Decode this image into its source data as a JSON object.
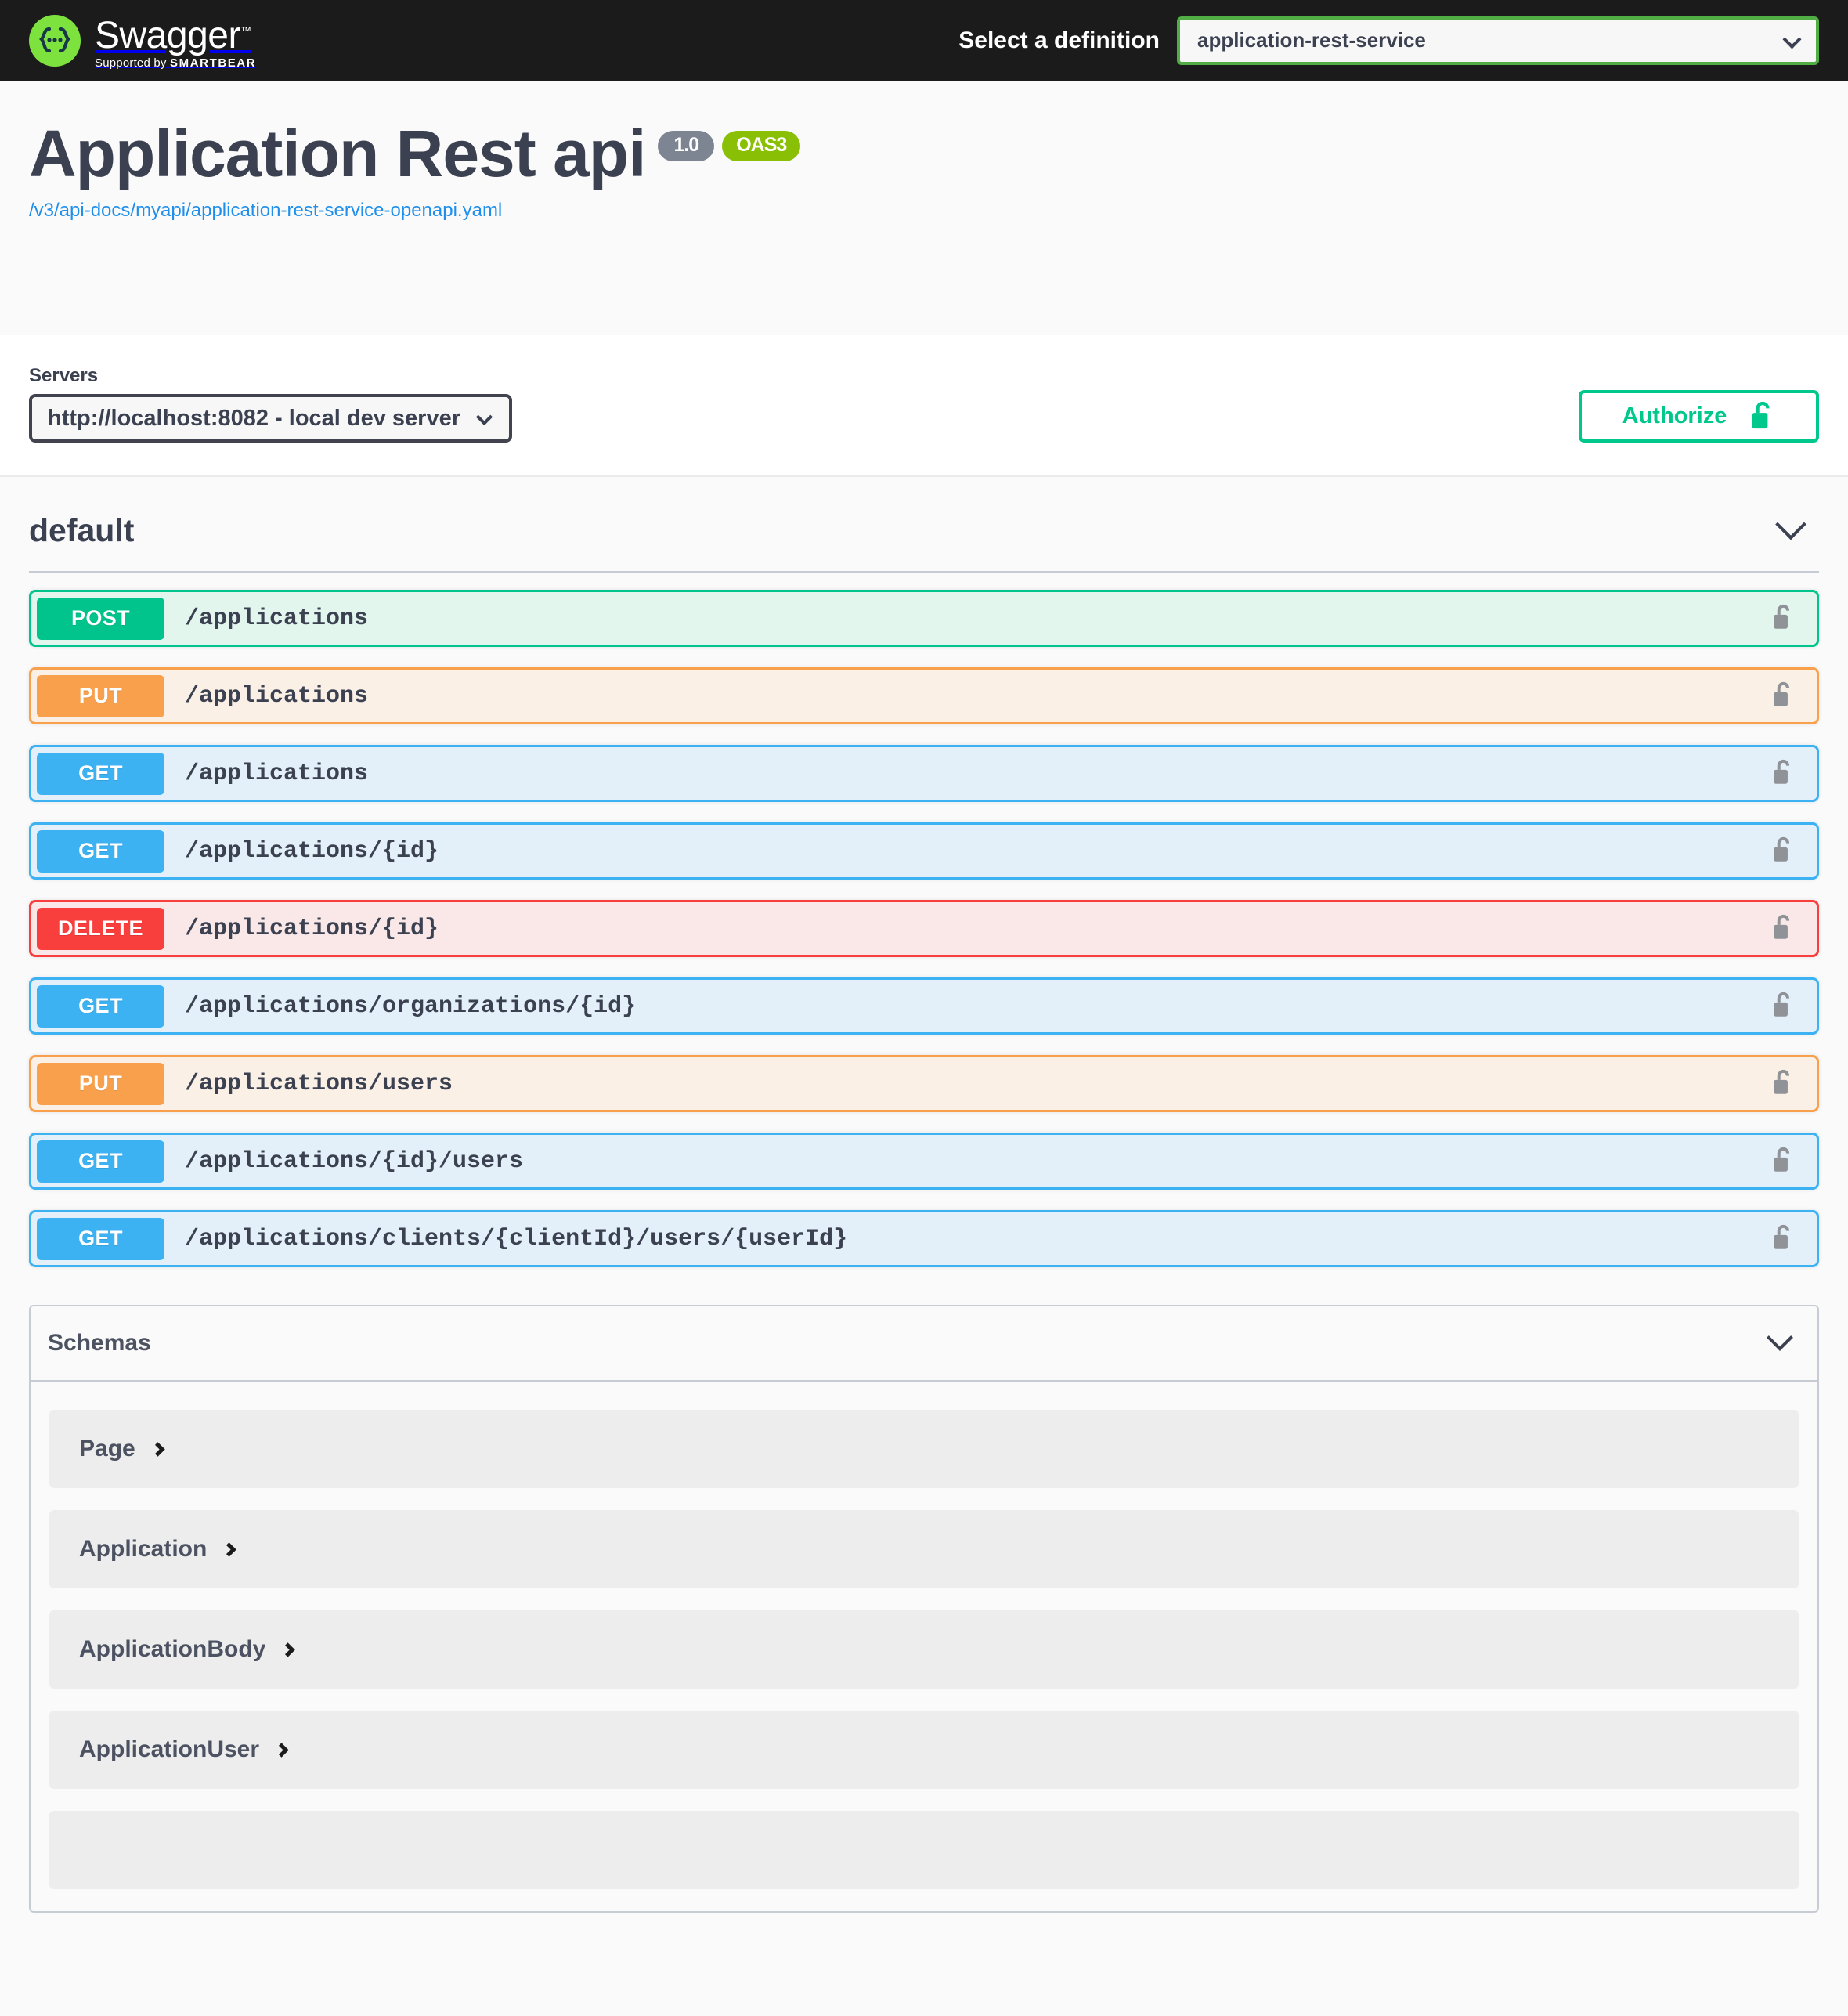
{
  "topbar": {
    "logo_name": "Swagger",
    "logo_tm": "™",
    "logo_supported_prefix": "Supported by ",
    "logo_supported_brand": "SMARTBEAR",
    "definition_label": "Select a definition",
    "definition_value": "application-rest-service"
  },
  "info": {
    "title": "Application Rest api",
    "version_badge": "1.0",
    "spec_badge": "OAS3",
    "url": "/v3/api-docs/myapi/application-rest-service-openapi.yaml"
  },
  "servers": {
    "label": "Servers",
    "selected": "http://localhost:8082 - local dev server",
    "authorize_label": "Authorize"
  },
  "tag": {
    "name": "default"
  },
  "operations": [
    {
      "method": "POST",
      "path": "/applications",
      "style": "post",
      "lock": "unlocked-padlock-icon"
    },
    {
      "method": "PUT",
      "path": "/applications",
      "style": "put",
      "lock": "unlocked-padlock-icon"
    },
    {
      "method": "GET",
      "path": "/applications",
      "style": "get",
      "lock": "unlocked-padlock-icon"
    },
    {
      "method": "GET",
      "path": "/applications/{id}",
      "style": "get",
      "lock": "unlocked-padlock-icon"
    },
    {
      "method": "DELETE",
      "path": "/applications/{id}",
      "style": "delete",
      "lock": "unlocked-padlock-icon"
    },
    {
      "method": "GET",
      "path": "/applications/organizations/{id}",
      "style": "get",
      "lock": "unlocked-padlock-icon"
    },
    {
      "method": "PUT",
      "path": "/applications/users",
      "style": "put",
      "lock": "unlocked-padlock-icon"
    },
    {
      "method": "GET",
      "path": "/applications/{id}/users",
      "style": "get",
      "lock": "unlocked-padlock-icon"
    },
    {
      "method": "GET",
      "path": "/applications/clients/{clientId}/users/{userId}",
      "style": "get",
      "lock": "unlocked-padlock-icon"
    }
  ],
  "schemas": {
    "title": "Schemas",
    "models": [
      {
        "name": "Page"
      },
      {
        "name": "Application"
      },
      {
        "name": "ApplicationBody"
      },
      {
        "name": "ApplicationUser"
      },
      {
        "name": ""
      }
    ]
  },
  "colors": {
    "post": "#00c48c",
    "put": "#f9a04c",
    "get": "#3cb2f3",
    "delete": "#f93e3e",
    "authorize": "#00c78c",
    "oas3_badge": "#89bf04",
    "version_badge": "#7d8492",
    "link": "#1f8feb",
    "topbar_bg": "#1b1b1b",
    "logo_green": "#7ee23e"
  }
}
